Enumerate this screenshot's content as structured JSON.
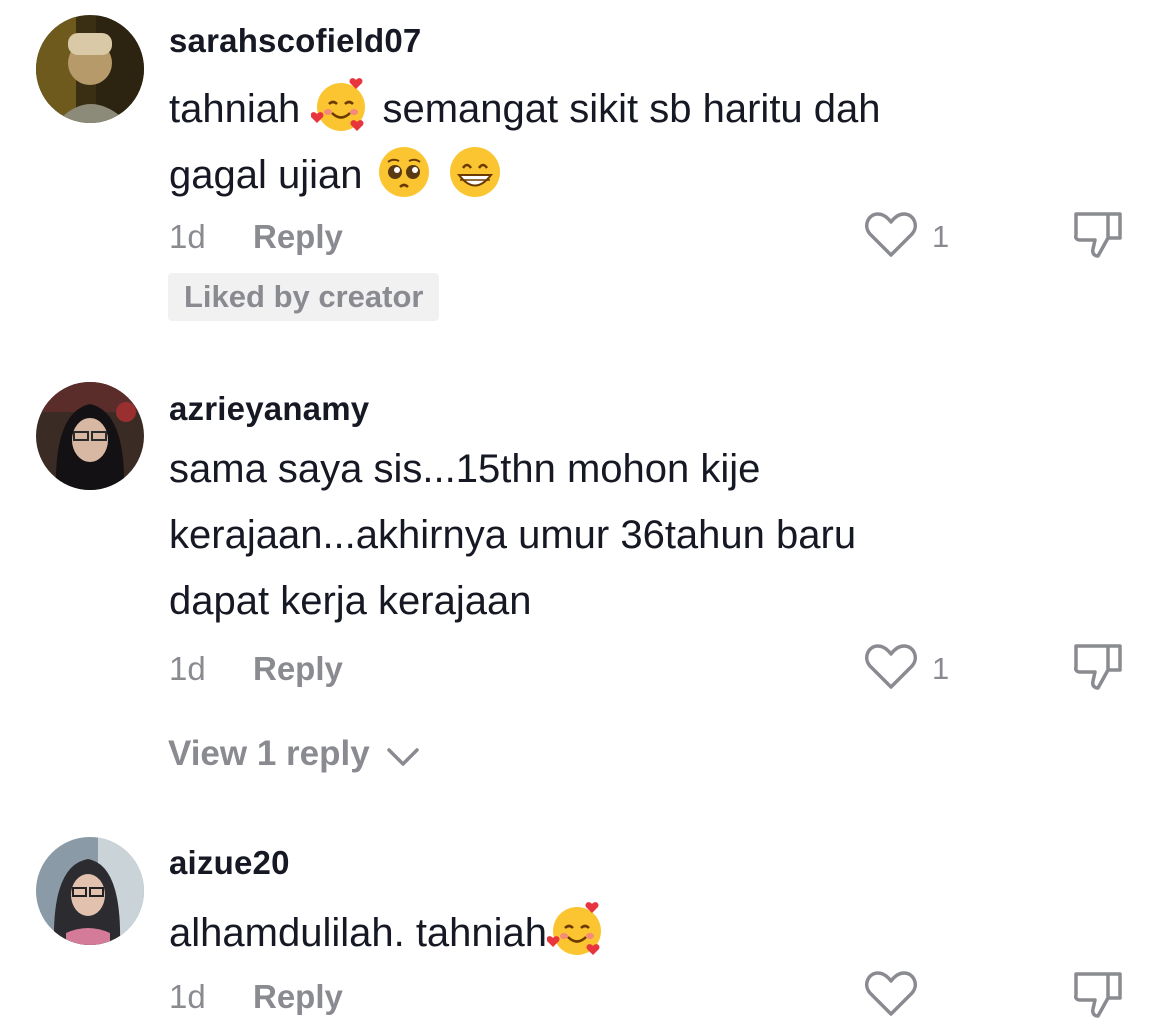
{
  "comments": [
    {
      "username": "sarahscofield07",
      "text_line1": "tahniah",
      "text_line1_after": "semangat sikit sb haritu dah",
      "text_line2": "gagal ujian",
      "time": "1d",
      "reply_label": "Reply",
      "like_count": "1",
      "badge": "Liked by creator"
    },
    {
      "username": "azrieyanamy",
      "text_line1": "sama saya sis...15thn mohon kije",
      "text_line2": "kerajaan...akhirnya umur 36tahun baru",
      "text_line3": "dapat kerja kerajaan",
      "time": "1d",
      "reply_label": "Reply",
      "like_count": "1",
      "view_replies": "View 1 reply"
    },
    {
      "username": "aizue20",
      "text_line1": "alhamdulilah. tahniah",
      "time": "1d",
      "reply_label": "Reply",
      "like_count": ""
    }
  ],
  "icons": {
    "like": "heart-outline-icon",
    "dislike": "thumbs-down-icon",
    "expand": "chevron-down-icon",
    "emoji_love": "smiling-face-with-hearts-emoji",
    "emoji_plead": "pleading-face-emoji",
    "emoji_grin": "grinning-face-emoji"
  },
  "colors": {
    "text": "#161823",
    "muted": "#8a8b91",
    "badge_bg": "#f1f1f2"
  }
}
